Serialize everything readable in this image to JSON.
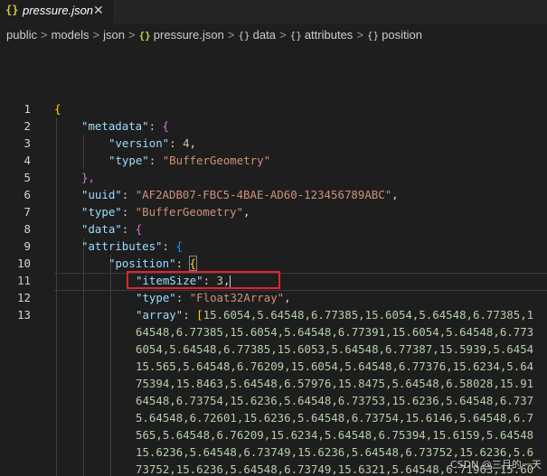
{
  "tab": {
    "filename": "pressure.json",
    "brace_icon": "{}",
    "close_icon": "✕"
  },
  "breadcrumbs": {
    "items": [
      "public",
      "models",
      "json",
      "pressure.json",
      "data",
      "attributes",
      "position"
    ],
    "separator": ">"
  },
  "editor": {
    "line_numbers": [
      "1",
      "2",
      "3",
      "4",
      "5",
      "6",
      "7",
      "8",
      "9",
      "10",
      "11",
      "12",
      "13"
    ],
    "active_line": "11",
    "lines": {
      "l1": "{",
      "l2_key": "\"metadata\"",
      "l2_brace": "{",
      "l3_key": "\"version\"",
      "l3_val": "4",
      "l4_key": "\"type\"",
      "l4_val": "\"BufferGeometry\"",
      "l5": "},",
      "l6_key": "\"uuid\"",
      "l6_val": "\"AF2ADB07-FBC5-4BAE-AD60-123456789ABC\"",
      "l7_key": "\"type\"",
      "l7_val": "\"BufferGeometry\"",
      "l8_key": "\"data\"",
      "l8_brace": "{",
      "l9_key": "\"attributes\"",
      "l9_brace": "{",
      "l10_key": "\"position\"",
      "l10_brace": "{",
      "l11_key": "\"itemSize\"",
      "l11_val": "3",
      "l12_key": "\"type\"",
      "l12_val": "\"Float32Array\"",
      "l13_key": "\"array\"",
      "l13_bracket": "[",
      "l13_first": "15.6054,5.64548,6.77385,15.6054,5.64548,6.77385,1",
      "wrap": [
        "64548,6.77385,15.6054,5.64548,6.77391,15.6054,5.64548,6.773",
        "6054,5.64548,6.77385,15.6053,5.64548,6.77387,15.5939,5.6454",
        "15.565,5.64548,6.76209,15.6054,5.64548,6.77376,15.6234,5.64",
        "75394,15.8463,5.64548,6.57976,15.8475,5.64548,6.58028,15.91",
        "64548,6.73754,15.6236,5.64548,6.73753,15.6236,5.64548,6.737",
        "5.64548,6.72601,15.6236,5.64548,6.73754,15.6146,5.64548,6.7",
        "565,5.64548,6.76209,15.6234,5.64548,6.75394,15.6159,5.64548",
        "15.6236,5.64548,6.73749,15.6236,5.64548,6.73752,15.6236,5.6",
        "73752,15.6236,5.64548,6.73749,15.6321,5.64548,6.71963,15.60"
      ]
    }
  },
  "watermark": "CSDN @三月的一天"
}
